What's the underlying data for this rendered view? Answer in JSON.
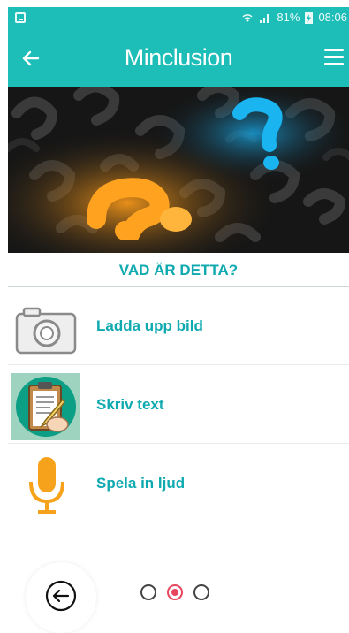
{
  "status_bar": {
    "battery": "81%",
    "time": "08:06"
  },
  "app_bar": {
    "title": "Minclusion"
  },
  "hero": {
    "icon": "question-marks-image"
  },
  "question": {
    "text": "VAD ÄR DETTA?"
  },
  "options": [
    {
      "label": "Ladda upp bild",
      "icon": "camera-icon"
    },
    {
      "label": "Skriv text",
      "icon": "clipboard-icon"
    },
    {
      "label": "Spela in ljud",
      "icon": "microphone-icon"
    }
  ],
  "pagination": {
    "total": 3,
    "current": 2
  },
  "colors": {
    "primary": "#1dbdb8",
    "accent_text": "#0fa9b0",
    "active_dot": "#e8455e"
  }
}
